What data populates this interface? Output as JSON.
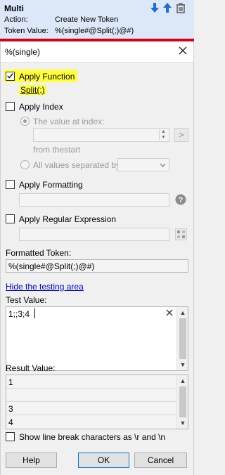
{
  "header": {
    "title": "Multi",
    "action_label": "Action:",
    "action_value": "Create New Token",
    "token_label": "Token Value:",
    "token_value": "%(single#@Split(;)@#)"
  },
  "dialog": {
    "title": "%(single)",
    "apply_function": {
      "label": "Apply Function",
      "checked": true,
      "sublabel": "Split(;)"
    },
    "apply_index": {
      "label": "Apply Index",
      "checked": false
    },
    "value_at_index": {
      "label": "The value at index:",
      "value": "",
      "go": ">"
    },
    "from_the": "from the",
    "start": "start",
    "all_values": {
      "label": "All values separated by:",
      "value": ""
    },
    "apply_formatting": {
      "label": "Apply Formatting",
      "checked": false,
      "value": ""
    },
    "apply_regex": {
      "label": "Apply Regular Expression",
      "checked": false,
      "value": ""
    },
    "formatted_token": {
      "label": "Formatted Token:",
      "value": "%(single#@Split(;)@#)"
    },
    "hide_testing_link": "Hide the testing area",
    "test_value": {
      "label": "Test Value:",
      "value": "1;;3;4"
    },
    "result_value": {
      "label": "Result Value:",
      "rows": [
        "1",
        "",
        "3",
        "4"
      ]
    },
    "show_line_break": {
      "label": "Show line break characters as \\r and \\n",
      "checked": false
    },
    "buttons": {
      "help": "Help",
      "ok": "OK",
      "cancel": "Cancel"
    }
  },
  "colors": {
    "highlight": "#ffff3c",
    "header_bg": "#dce8f8",
    "accent_red": "#d0021b",
    "icon_blue": "#1a6fd6"
  },
  "icons": [
    "arrow-down-icon",
    "arrow-up-icon",
    "trash-icon",
    "close-icon",
    "help-icon",
    "regex-icon",
    "clear-icon"
  ]
}
